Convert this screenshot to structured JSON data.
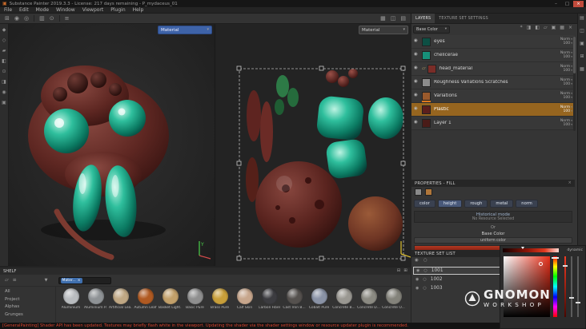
{
  "title_bar": {
    "app_icon": "▣",
    "title": "Substance Painter 2019.3.3 - License: 217 days remaining - P_mydaceus_01",
    "minimize": "–",
    "maximize": "□",
    "close": "×"
  },
  "menu_bar": {
    "items": [
      {
        "label": "File"
      },
      {
        "label": "Edit"
      },
      {
        "label": "Mode"
      },
      {
        "label": "Window"
      },
      {
        "label": "Viewport"
      },
      {
        "label": "Plugin"
      },
      {
        "label": "Help"
      }
    ]
  },
  "icons": {
    "eye": "◉",
    "folder": "▱",
    "dropdown": "▾",
    "close": "×",
    "add": "+",
    "dock": "⊞",
    "brush_round": "◉",
    "brush_soft": "◎",
    "grid": "▥",
    "stencil": "⊙",
    "lines": "≡",
    "display": "▦",
    "camera": "◫",
    "panel": "▤",
    "paint": "◆",
    "erase": "◇",
    "proj": "▰",
    "fillA": "◧",
    "fillB": "◨",
    "smudge": "⊙",
    "pick": "◉",
    "mask": "▣",
    "funnel": "▼",
    "circle": "○",
    "collapse": "⊟",
    "grid2": "⊞",
    "star": "*"
  },
  "viewports": {
    "view3d_mode": "Material",
    "view2d_mode": "Material",
    "axis_label_y": "Y"
  },
  "right_panel": {
    "tabs": [
      {
        "label": "LAYERS"
      },
      {
        "label": "TEXTURE SET SETTINGS"
      }
    ],
    "channel_filter_label": "Base Color",
    "layers": [
      {
        "name": "eyes",
        "blend": "Norm",
        "opacity": "100",
        "thumb": "#0d4f44"
      },
      {
        "name": "chelicerae",
        "blend": "Norm",
        "opacity": "100",
        "thumb": "#17907a"
      },
      {
        "name": "head_material",
        "blend": "Norm",
        "opacity": "100",
        "thumb": "#7a2d28",
        "folder": true
      },
      {
        "name": "Roughness Variations Scratches",
        "blend": "Norm",
        "opacity": "100",
        "thumb": "#8c8c8c"
      },
      {
        "name": "Variations",
        "blend": "Norm",
        "opacity": "100",
        "thumb": "#9a5a2c",
        "mask_bar": "#e0791e"
      },
      {
        "name": "Plastic",
        "blend": "Norm",
        "opacity": "100",
        "thumb": "#5c1f1c",
        "selected": true
      },
      {
        "name": "Layer 1",
        "blend": "Norm",
        "opacity": "100",
        "thumb": "#4a1b18"
      }
    ]
  },
  "properties_panel": {
    "title": "PROPERTIES - FILL",
    "channel_buttons": [
      {
        "label": "color"
      },
      {
        "label": "height"
      },
      {
        "label": "rough"
      },
      {
        "label": "metal"
      },
      {
        "label": "norm"
      }
    ],
    "mode_title": "Historical mode",
    "mode_subtitle": "No Resource Selected",
    "or_label": "Or",
    "base_color_label": "Base Color",
    "uniform_color_label": "uniform color",
    "swatch_color": "#a83220"
  },
  "texture_set_list": {
    "title": "TEXTURE SET LIST",
    "sets": [
      {
        "label": "1001",
        "selected": true
      },
      {
        "label": "1002"
      },
      {
        "label": "1003"
      }
    ]
  },
  "color_picker": {
    "dynamic_label": "dynamic"
  },
  "shelf": {
    "title": "SHELF",
    "filter_chip": "Mater...",
    "categories": [
      {
        "label": "All"
      },
      {
        "label": "Project"
      },
      {
        "label": "Alphas"
      },
      {
        "label": "Grunges"
      }
    ],
    "materials": [
      {
        "label": "Aluminium",
        "color": "#b9bcbf"
      },
      {
        "label": "Aluminium P...",
        "color": "#8f9396"
      },
      {
        "label": "Artificial Lea...",
        "color": "#c0a884"
      },
      {
        "label": "Autumn Leaf",
        "color": "#b05a22"
      },
      {
        "label": "Basket Light...",
        "color": "#c2a06a"
      },
      {
        "label": "Basic Pure",
        "color": "#8f8f8f"
      },
      {
        "label": "Brass Pure",
        "color": "#c89f3a"
      },
      {
        "label": "Calf Skin",
        "color": "#c7a68c"
      },
      {
        "label": "Carbon Fiber",
        "color": "#3c3c40"
      },
      {
        "label": "Cast Iron B...",
        "color": "#55514e"
      },
      {
        "label": "Cobalt Pure",
        "color": "#8a93a6"
      },
      {
        "label": "Concrete B...",
        "color": "#9a9892"
      },
      {
        "label": "Concrete D...",
        "color": "#8b8a82"
      },
      {
        "label": "Concrete O...",
        "color": "#84837b"
      }
    ]
  },
  "status_bar": {
    "message": "[GeneralPainting] Shader API has been updated. Textures may briefly flash white in the viewport. Updating the shader via the shader settings window or resource updater plugin is recommended."
  },
  "watermark": {
    "line1": "GNOMON",
    "line2": "WORKSHOP"
  }
}
